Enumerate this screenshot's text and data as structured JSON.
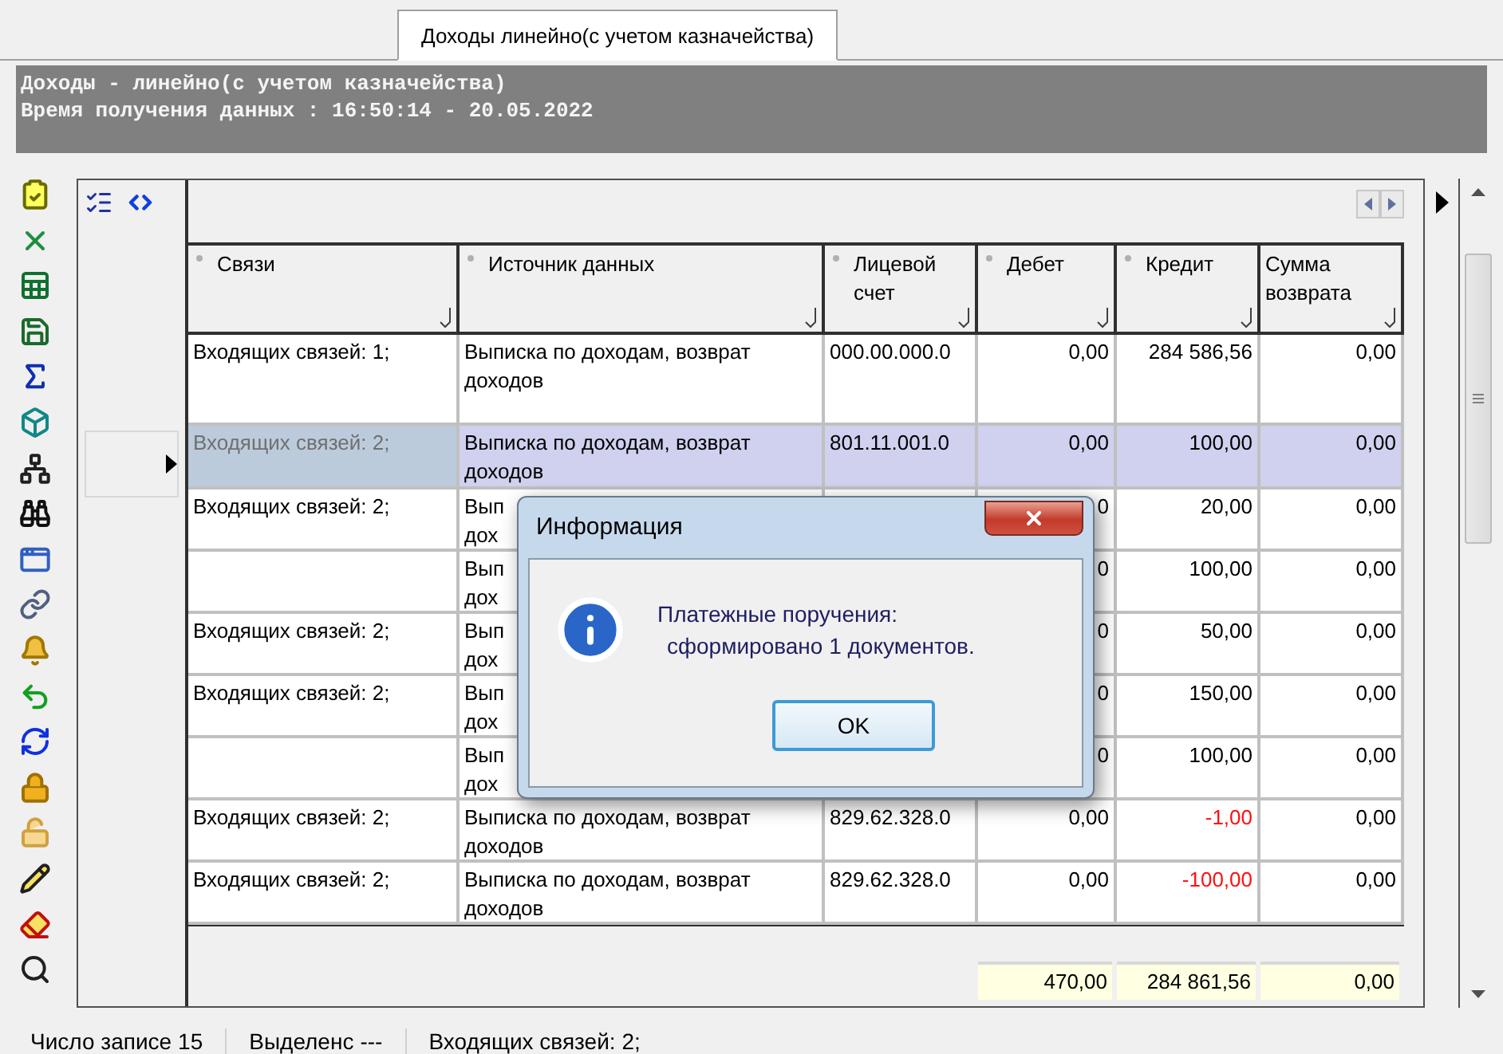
{
  "tab": {
    "label": "Доходы линейно(с учетом казначейства)",
    "selected": true
  },
  "report_header": {
    "title": "Доходы - линейно(с учетом казначейства)",
    "timestamp": "Время получения данных : 16:50:14 - 20.05.2022"
  },
  "grid": {
    "columns": [
      {
        "label": "Связи",
        "kind": "text",
        "marker": true
      },
      {
        "label": "Источник данных",
        "kind": "text",
        "marker": true
      },
      {
        "label": "Лицевой счет",
        "kind": "text",
        "marker": true
      },
      {
        "label": "Дебет",
        "kind": "number",
        "marker": true
      },
      {
        "label": "Кредит",
        "kind": "number",
        "marker": true
      },
      {
        "label": "Сумма возврата",
        "kind": "number",
        "marker": false
      }
    ],
    "rows": [
      {
        "links": "Входящих связей: 1;",
        "source": "Выписка по доходам, возврат доходов",
        "account": "000.00.000.0",
        "debit": "0,00",
        "credit": "284 586,56",
        "refund": "0,00",
        "selected": false,
        "credit_negative": false
      },
      {
        "links": "Входящих связей: 2;",
        "source": "Выписка по доходам, возврат доходов",
        "account": "801.11.001.0",
        "debit": "0,00",
        "credit": "100,00",
        "refund": "0,00",
        "selected": true,
        "credit_negative": false
      },
      {
        "links": "Входящих связей: 2;",
        "source": "Вып\nдох",
        "debit": "0",
        "credit": "20,00",
        "refund": "0,00",
        "selected": false,
        "credit_negative": false
      },
      {
        "source": "Вып\nдох",
        "debit": "0",
        "credit": "100,00",
        "refund": "0,00",
        "selected": false,
        "credit_negative": false
      },
      {
        "links": "Входящих связей: 2;",
        "source": "Вып\nдох",
        "debit": "0",
        "credit": "50,00",
        "refund": "0,00",
        "selected": false,
        "credit_negative": false
      },
      {
        "links": "Входящих связей: 2;",
        "source": "Вып\nдох",
        "debit": "0",
        "credit": "150,00",
        "refund": "0,00",
        "selected": false,
        "credit_negative": false
      },
      {
        "source": "Вып\nдох",
        "debit": "0",
        "credit": "100,00",
        "refund": "0,00",
        "selected": false,
        "credit_negative": false
      },
      {
        "links": "Входящих связей: 2;",
        "source": "Выписка по доходам, возврат доходов",
        "account": "829.62.328.0",
        "debit": "0,00",
        "credit": "-1,00",
        "refund": "0,00",
        "selected": false,
        "credit_negative": true
      },
      {
        "links": "Входящих связей: 2;",
        "source": "Выписка по доходам, возврат доходов",
        "account": "829.62.328.0",
        "debit": "0,00",
        "credit": "-100,00",
        "refund": "0,00",
        "selected": false,
        "credit_negative": true
      }
    ],
    "totals": [
      "470,00",
      "284 861,56",
      "0,00"
    ]
  },
  "dialog": {
    "title": "Информация",
    "message": [
      "Платежные поручения:",
      "сформировано 1 документов."
    ],
    "button": "OK"
  },
  "status_bar": [
    {
      "label": "Число записе",
      "value": "15"
    },
    {
      "label": "Выделенс",
      "value": "---"
    },
    {
      "label": "Входящих связей: 2;"
    }
  ]
}
